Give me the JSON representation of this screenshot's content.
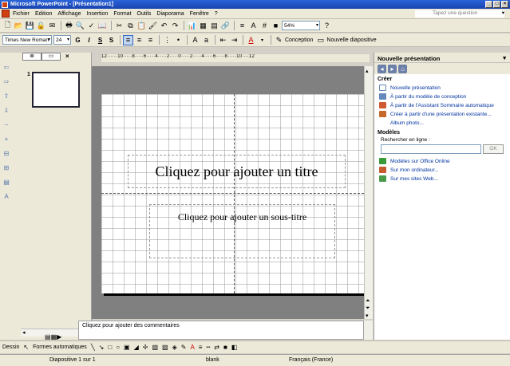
{
  "window": {
    "title": "Microsoft PowerPoint - [Présentation1]"
  },
  "menu": {
    "items": [
      "Fichier",
      "Edition",
      "Affichage",
      "Insertion",
      "Format",
      "Outils",
      "Diaporama",
      "Fenêtre",
      "?"
    ],
    "help_placeholder": "Tapez une question"
  },
  "toolbar": {
    "zoom": "54%",
    "font_name": "Times New Roman",
    "font_size": "24",
    "bold": "G",
    "italic": "I",
    "underline": "S",
    "shadow": "S",
    "conception": "Conception",
    "new_slide": "Nouvelle diapositive"
  },
  "outline": {
    "slide_number": "1"
  },
  "ruler": {
    "h_ticks": "12······10·····8·····6·····4·····2·····0·····2·····4·····6·····8·····10····12"
  },
  "slide": {
    "title_placeholder": "Cliquez pour ajouter un titre",
    "subtitle_placeholder": "Cliquez pour ajouter un sous-titre"
  },
  "notes": {
    "placeholder": "Cliquez pour ajouter des commentaires"
  },
  "taskpane": {
    "title": "Nouvelle présentation",
    "create_header": "Créer",
    "links": [
      "Nouvelle présentation",
      "À partir du modèle de conception",
      "À partir de l'Assistant Sommaire automatique",
      "Créer à partir d'une présentation existante...",
      "Album photo..."
    ],
    "models_header": "Modèles",
    "search_label": "Rechercher en ligne :",
    "ok": "OK",
    "model_links": [
      "Modèles sur Office Online",
      "Sur mon ordinateur...",
      "Sur mes sites Web..."
    ]
  },
  "drawing": {
    "draw_label": "Dessin",
    "autoshapes": "Formes automatiques"
  },
  "status": {
    "slide": "Diapositive 1 sur 1",
    "design": "blank",
    "language": "Français (France)"
  }
}
